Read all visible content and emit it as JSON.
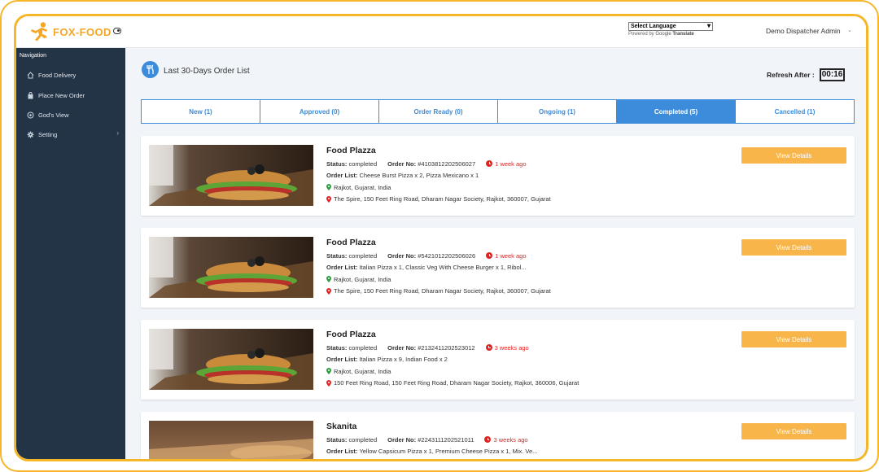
{
  "brand": {
    "name": "FOX-FOOD",
    "color": "#f5a623"
  },
  "header": {
    "language_select": "Select Language",
    "powered_by": "Powered by",
    "google": "Google",
    "translate": "Translate",
    "user": "Demo Dispatcher Admin"
  },
  "sidebar": {
    "title": "Navigation",
    "items": [
      {
        "label": "Food Delivery",
        "icon": "home-icon"
      },
      {
        "label": "Place New Order",
        "icon": "bag-icon"
      },
      {
        "label": "God's View",
        "icon": "eye-icon"
      },
      {
        "label": "Setting",
        "icon": "gear-icon"
      }
    ]
  },
  "page": {
    "title": "Last 30-Days Order List",
    "refresh_label": "Refresh After :",
    "refresh_timer": "00:16"
  },
  "tabs": [
    {
      "label": "New (1)"
    },
    {
      "label": "Approved (0)"
    },
    {
      "label": "Order Ready (0)"
    },
    {
      "label": "Ongoing (1)"
    },
    {
      "label": "Completed (5)"
    },
    {
      "label": "Cancelled (1)"
    }
  ],
  "labels": {
    "status": "Status:",
    "order_no": "Order No:",
    "order_list": "Order List:",
    "view_details": "View Details"
  },
  "orders": [
    {
      "restaurant": "Food Plazza",
      "status": "completed",
      "order_no": "#4103812202506027",
      "time_ago": "1 week ago",
      "order_list": "Cheese Burst Pizza x 2, Pizza Mexicano x 1",
      "pickup": "Rajkot, Gujarat, India",
      "dropoff": "The Spire, 150 Feet Ring Road, Dharam Nagar Society, Rajkot, 360007, Gujarat"
    },
    {
      "restaurant": "Food Plazza",
      "status": "completed",
      "order_no": "#5421012202506026",
      "time_ago": "1 week ago",
      "order_list": "Italian Pizza x 1, Classic Veg With Cheese Burger x 1, Ribol...",
      "pickup": "Rajkot, Gujarat, India",
      "dropoff": "The Spire, 150 Feet Ring Road, Dharam Nagar Society, Rajkot, 360007, Gujarat"
    },
    {
      "restaurant": "Food Plazza",
      "status": "completed",
      "order_no": "#2132411202523012",
      "time_ago": "3 weeks ago",
      "order_list": "Italian Pizza x 9, Indian Food x 2",
      "pickup": "Rajkot, Gujarat, India",
      "dropoff": "150 Feet Ring Road, 150 Feet Ring Road, Dharam Nagar Society, Rajkot, 360006, Gujarat"
    },
    {
      "restaurant": "Skanita",
      "status": "completed",
      "order_no": "#2243111202521011",
      "time_ago": "3 weeks ago",
      "order_list": "Yellow Capsicum Pizza x 1, Premium Cheese Pizza x 1, Mix. Ve...",
      "pickup": "",
      "dropoff": ""
    }
  ],
  "colors": {
    "accent": "#3d8cdb",
    "button": "#f8b54a",
    "sidebar": "#243447",
    "time": "#e02424",
    "frame": "#f5b62a"
  }
}
